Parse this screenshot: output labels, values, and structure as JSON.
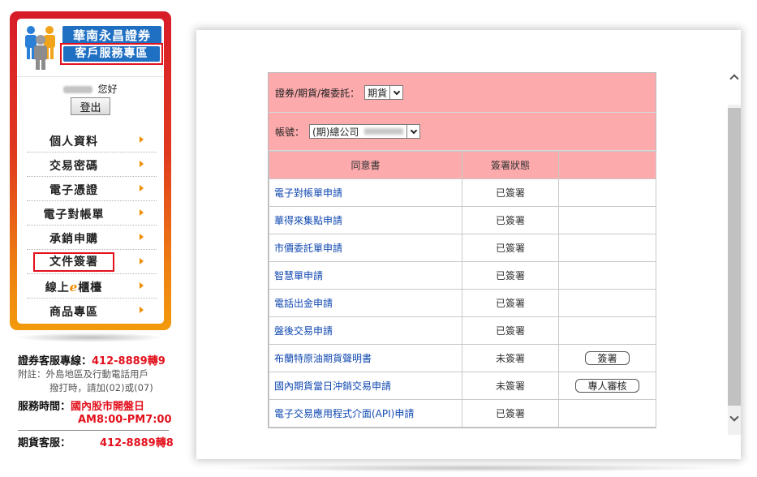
{
  "brand": {
    "line1": "華南永昌證券",
    "line2": "客戶服務專區"
  },
  "greeting": {
    "text": "您好"
  },
  "logout": {
    "label": "登出"
  },
  "menu": {
    "items": [
      {
        "label": "個人資料",
        "active": false
      },
      {
        "label": "交易密碼",
        "active": false
      },
      {
        "label": "電子憑證",
        "active": false
      },
      {
        "label": "電子對帳單",
        "active": false
      },
      {
        "label": "承銷申購",
        "active": false
      },
      {
        "label": "文件簽署",
        "active": true
      },
      {
        "label_prefix": "線上",
        "label_e": "e",
        "label_suffix": "櫃檯",
        "active": false
      },
      {
        "label": "商品專區",
        "active": false
      }
    ]
  },
  "service": {
    "hotline_label": "證券客服專線：",
    "hotline_value": "412-8889轉9",
    "note_line1": "附註：外島地區及行動電話用戶",
    "note_line2": "撥打時，請加(02)或(07)",
    "hours_label": "服務時間：",
    "hours_value1": "國內股市開盤日",
    "hours_value2": "AM8:00-PM7:00",
    "futures_label": "期貨客服：",
    "futures_value": "412-8889轉8"
  },
  "form": {
    "type_label": "證券/期貨/複委託：",
    "type_selected": "期貨",
    "account_label": "帳號：",
    "account_selected": "(期)總公司"
  },
  "table": {
    "headers": [
      "同意書",
      "簽署狀態",
      ""
    ],
    "rows": [
      {
        "name": "電子對帳單申請",
        "status": "已簽署",
        "action": ""
      },
      {
        "name": "華得來集點申請",
        "status": "已簽署",
        "action": ""
      },
      {
        "name": "市價委託單申請",
        "status": "已簽署",
        "action": ""
      },
      {
        "name": "智慧單申請",
        "status": "已簽署",
        "action": ""
      },
      {
        "name": "電話出金申請",
        "status": "已簽署",
        "action": ""
      },
      {
        "name": "盤後交易申請",
        "status": "已簽署",
        "action": ""
      },
      {
        "name": "布蘭特原油期貨聲明書",
        "status": "未簽署",
        "action": "簽署"
      },
      {
        "name": "國內期貨當日沖銷交易申請",
        "status": "未簽署",
        "action": "專人審核"
      },
      {
        "name": "電子交易應用程式介面(API)申請",
        "status": "已簽署",
        "action": ""
      }
    ]
  },
  "colors": {
    "accent_red": "#e3111d",
    "brand_blue": "#1f6fc3",
    "table_pink": "#fcaaac",
    "link_blue": "#1048b0"
  }
}
